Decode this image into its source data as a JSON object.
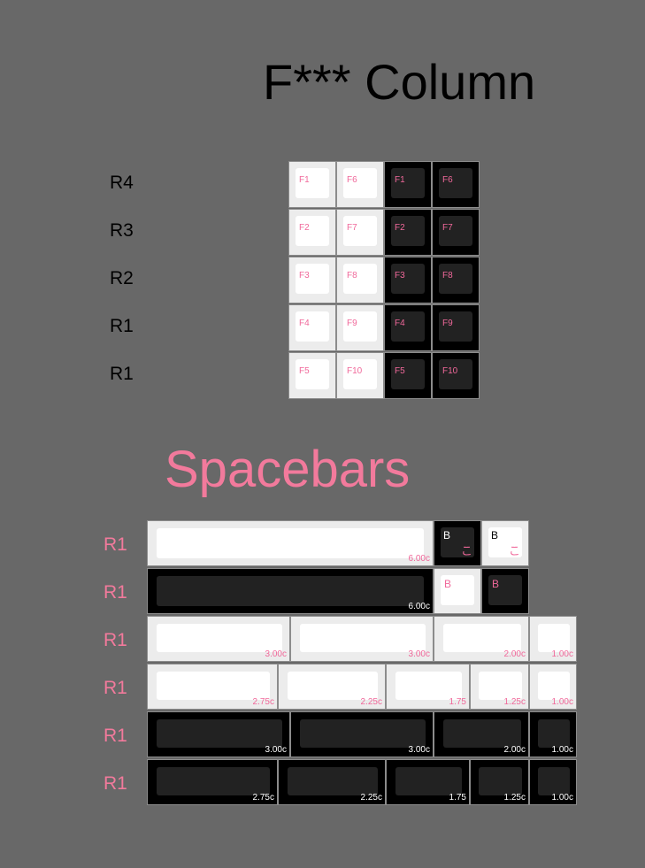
{
  "f_column": {
    "title": "F*** Column",
    "row_labels": [
      "R4",
      "R3",
      "R2",
      "R1",
      "R1"
    ],
    "keys": [
      [
        "F1",
        "F6",
        "F1",
        "F6"
      ],
      [
        "F2",
        "F7",
        "F2",
        "F7"
      ],
      [
        "F3",
        "F8",
        "F3",
        "F8"
      ],
      [
        "F4",
        "F9",
        "F4",
        "F9"
      ],
      [
        "F5",
        "F10",
        "F5",
        "F10"
      ]
    ]
  },
  "spacebars": {
    "title": "Spacebars",
    "row_labels": [
      "R1",
      "R1",
      "R1",
      "R1",
      "R1",
      "R1"
    ],
    "row1": {
      "size": "6.00c",
      "b_key_1": "B",
      "b_key_1_jp": "こ",
      "b_key_2": "B",
      "b_key_2_jp": "こ"
    },
    "row2": {
      "size": "6.00c",
      "b_key_1": "B",
      "b_key_2": "B"
    },
    "row3_sizes": [
      "3.00c",
      "3.00c",
      "2.00c",
      "1.00c"
    ],
    "row4_sizes": [
      "2.75c",
      "2.25c",
      "1.75",
      "1.25c",
      "1.00c"
    ],
    "row5_sizes": [
      "3.00c",
      "3.00c",
      "2.00c",
      "1.00c"
    ],
    "row6_sizes": [
      "2.75c",
      "2.25c",
      "1.75",
      "1.25c",
      "1.00c"
    ]
  },
  "colors": {
    "background": "#686868",
    "accent_pink": "#f27a9c",
    "key_white": "#ececec",
    "key_black": "#000000"
  }
}
